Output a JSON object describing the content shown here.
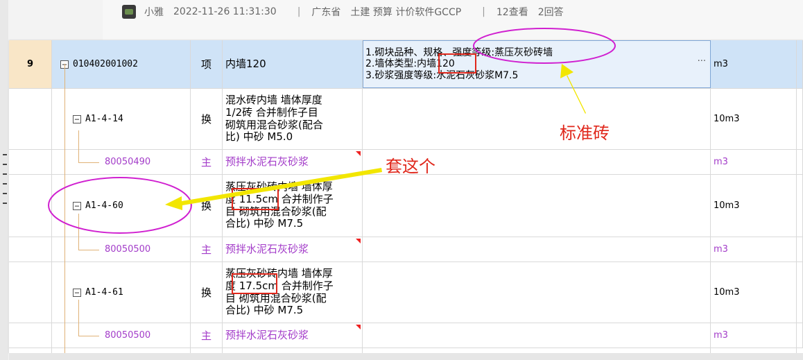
{
  "post": {
    "author": "小雅",
    "datetime": "2022-11-26 11:31:30",
    "separator": "|",
    "region": "广东省",
    "tags": "土建 预算 计价软件GCCP",
    "views": "12查看",
    "answers": "2回答"
  },
  "grid": {
    "rows": [
      {
        "num": "9",
        "code": "010402001002",
        "type": "项",
        "name": "内墙120",
        "desc_lines": [
          "1.砌块品种、规格、强度等级:蒸压灰砂砖墙",
          "2.墙体类型:内墙120",
          "3.砂浆强度等级:水泥石灰砂浆M7.5"
        ],
        "unit": "m3",
        "ellipsis": "···"
      },
      {
        "num": "",
        "code": "A1-4-14",
        "type": "换",
        "name_lines": [
          "混水砖内墙 墙体厚度",
          "1/2砖  合并制作子目",
          "砌筑用混合砂浆(配合",
          "比) 中砂 M5.0"
        ],
        "unit": "10m3"
      },
      {
        "num": "",
        "code": "80050490",
        "type": "主",
        "name": "预拌水泥石灰砂浆",
        "unit": "m3"
      },
      {
        "num": "",
        "code": "A1-4-60",
        "type": "换",
        "name_lines": [
          "蒸压灰砂砖内墙 墙体厚",
          "度 11.5cm  合并制作子",
          "目 砌筑用混合砂浆(配",
          "合比) 中砂 M7.5"
        ],
        "unit": "10m3"
      },
      {
        "num": "",
        "code": "80050500",
        "type": "主",
        "name": "预拌水泥石灰砂浆",
        "unit": "m3"
      },
      {
        "num": "",
        "code": "A1-4-61",
        "type": "换",
        "name_lines": [
          "蒸压灰砂砖内墙 墙体厚",
          "度 17.5cm  合并制作子",
          "目 砌筑用混合砂浆(配",
          "合比) 中砂 M7.5"
        ],
        "unit": "10m3"
      },
      {
        "num": "",
        "code": "80050500",
        "type": "主",
        "name": "预拌水泥石灰砂浆",
        "unit": "m3"
      }
    ],
    "tree_toggle": "−"
  },
  "annotations": {
    "standard_brick": "标准砖",
    "use_this": "套这个"
  },
  "colors": {
    "annotation_red": "#e0271b",
    "annotation_magenta": "#d020d0",
    "annotation_yellow": "#f2e600",
    "material_purple": "#a33cc9"
  }
}
